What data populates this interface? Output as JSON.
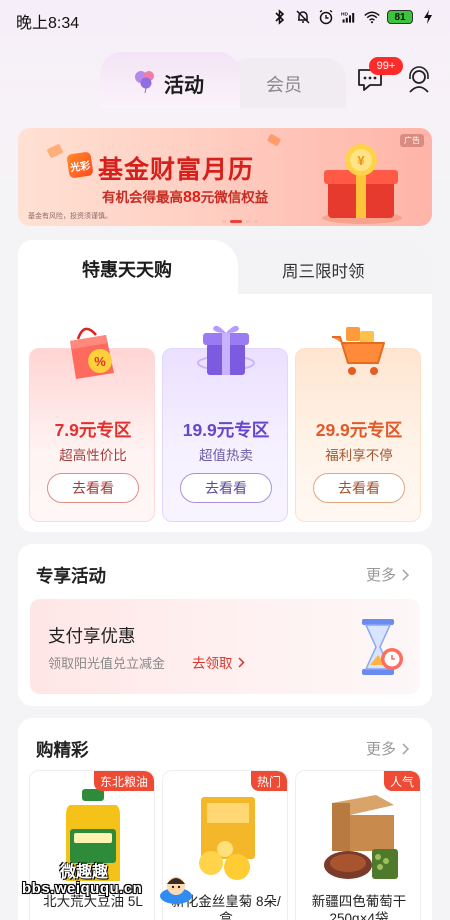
{
  "status_bar": {
    "time": "晚上8:34",
    "battery": "81",
    "icons": [
      "bluetooth-icon",
      "mute-bell-icon",
      "alarm-icon",
      "hd-signal-icon",
      "wifi-icon",
      "battery-icon",
      "charging-icon"
    ]
  },
  "top_tabs": {
    "active": "活动",
    "inactive": "会员",
    "message_badge": "99+"
  },
  "banner": {
    "logo": "光彩",
    "title": "基金财富月历",
    "subtitle_prefix": "有机会得最高",
    "subtitle_number": "88",
    "subtitle_suffix": "元微信权益",
    "disclaimer": "基金有风险，投资须谨慎。",
    "ad_label": "广告"
  },
  "deals": {
    "tabs": [
      "特惠天天购",
      "周三限时领"
    ],
    "tiles": [
      {
        "title": "7.9元专区",
        "subtitle": "超高性价比",
        "button": "去看看",
        "image": "shopping-bag-icon"
      },
      {
        "title": "19.9元专区",
        "subtitle": "超值热卖",
        "button": "去看看",
        "image": "gift-box-icon"
      },
      {
        "title": "29.9元专区",
        "subtitle": "福利享不停",
        "button": "去看看",
        "image": "shopping-cart-icon"
      }
    ]
  },
  "exclusive": {
    "title": "专享活动",
    "more": "更多",
    "item_title": "支付享优惠",
    "item_subtitle": "领取阳光值兑立减金",
    "item_cta": "去领取"
  },
  "shop": {
    "title": "购精彩",
    "more": "更多",
    "products": [
      {
        "badge": "东北粮油",
        "name": "北大荒大豆油 5L"
      },
      {
        "badge": "热门",
        "name": "新化金丝皇菊 8朵/盒"
      },
      {
        "badge": "人气",
        "name": "新疆四色葡萄干 250g×4袋"
      }
    ]
  },
  "watermark": {
    "title": "微趣趣",
    "url": "bbs.weiququ.cn"
  },
  "colors": {
    "accent_red": "#e2312d",
    "accent_purple": "#6547c9",
    "accent_orange": "#e2592a",
    "badge_red": "#ff2b2b"
  }
}
